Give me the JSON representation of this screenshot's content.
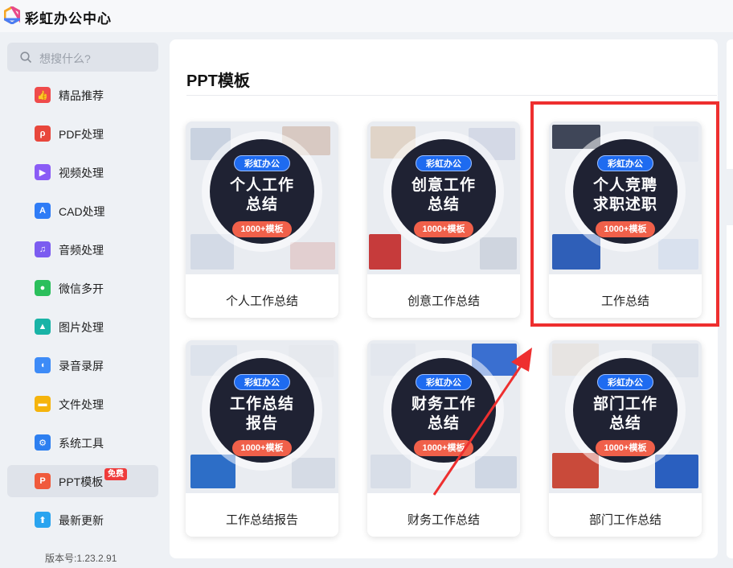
{
  "app": {
    "title": "彩虹办公中心"
  },
  "search": {
    "placeholder": "想搜什么?"
  },
  "sidebar": {
    "items": [
      {
        "label": "精品推荐",
        "icon": "thumbs-up-icon",
        "color": "#ef4b4b"
      },
      {
        "label": "PDF处理",
        "icon": "pdf-icon",
        "color": "#e8473c"
      },
      {
        "label": "视频处理",
        "icon": "video-play-icon",
        "color": "#8a5cf6"
      },
      {
        "label": "CAD处理",
        "icon": "cad-icon",
        "color": "#2f7cf6"
      },
      {
        "label": "音频处理",
        "icon": "music-note-icon",
        "color": "#7b5cf0"
      },
      {
        "label": "微信多开",
        "icon": "wechat-icon",
        "color": "#2bbf5c"
      },
      {
        "label": "图片处理",
        "icon": "image-icon",
        "color": "#19b3a6"
      },
      {
        "label": "录音录屏",
        "icon": "microphone-icon",
        "color": "#3d8bf7"
      },
      {
        "label": "文件处理",
        "icon": "folder-icon",
        "color": "#f5b40c"
      },
      {
        "label": "系统工具",
        "icon": "gear-icon",
        "color": "#2d7ff0"
      },
      {
        "label": "PPT模板",
        "icon": "ppt-icon",
        "color": "#f05a3c",
        "badge": "免费",
        "active": true
      },
      {
        "label": "最新更新",
        "icon": "upload-arrow-icon",
        "color": "#2aa4ef"
      }
    ],
    "version": "版本号:1.23.2.91"
  },
  "main": {
    "title": "PPT模板",
    "cards": [
      {
        "label": "个人工作总结",
        "brand": "彩虹办公",
        "big": [
          "个人工作",
          "总结"
        ],
        "count": "1000+模板"
      },
      {
        "label": "创意工作总结",
        "brand": "彩虹办公",
        "big": [
          "创意工作",
          "总结"
        ],
        "count": "1000+模板"
      },
      {
        "label": "工作总结",
        "brand": "彩虹办公",
        "big": [
          "个人竞聘",
          "求职述职"
        ],
        "count": "1000+模板",
        "highlighted": true
      },
      {
        "label": "工作总结报告",
        "brand": "彩虹办公",
        "big": [
          "工作总结",
          "报告"
        ],
        "count": "1000+模板"
      },
      {
        "label": "财务工作总结",
        "brand": "彩虹办公",
        "big": [
          "财务工作",
          "总结"
        ],
        "count": "1000+模板"
      },
      {
        "label": "部门工作总结",
        "brand": "彩虹办公",
        "big": [
          "部门工作",
          "总结"
        ],
        "count": "1000+模板"
      }
    ]
  },
  "colors": {
    "highlight": "#ee2f2f",
    "brand_pill": "#1e6bf0",
    "count_pill": "#f0604a",
    "badge_bg": "#1f2233"
  }
}
